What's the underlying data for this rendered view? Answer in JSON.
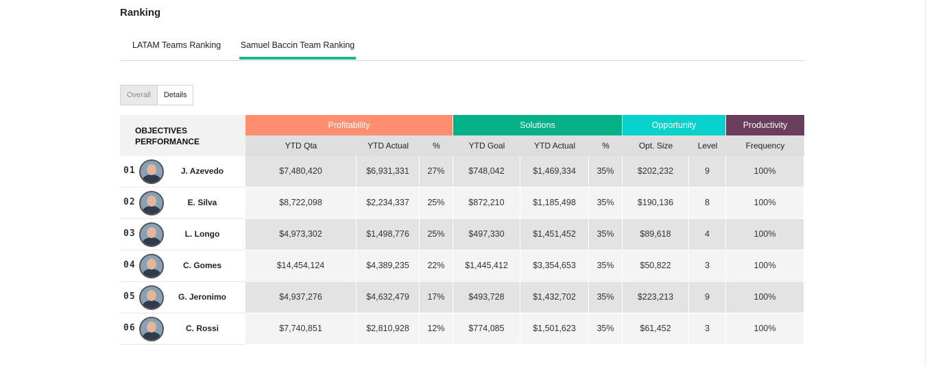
{
  "page": {
    "title": "Ranking"
  },
  "tabs": [
    "LATAM Teams Ranking",
    "Samuel Baccin Team Ranking"
  ],
  "active_tab": "Samuel Baccin Team Ranking",
  "view_toggle": {
    "options": [
      "Overall",
      "Details"
    ],
    "selected": "Details"
  },
  "table": {
    "corner_title": "OBJECTIVES PERFORMANCE",
    "groups": [
      {
        "label": "Profitability",
        "color": "#fd8f6f"
      },
      {
        "label": "Solutions",
        "color": "#04b187"
      },
      {
        "label": "Opportunity",
        "color": "#07d2cc"
      },
      {
        "label": "Productivity",
        "color": "#6a3d5c"
      }
    ],
    "columns": [
      "YTD Qta",
      "YTD Actual",
      "%",
      "YTD Goal",
      "YTD Actual",
      "%",
      "Opt. Size",
      "Level",
      "Frequency"
    ],
    "rows": [
      {
        "rank": "01",
        "name": "J. Azevedo",
        "values": [
          "$7,480,420",
          "$6,931,331",
          "27%",
          "$748,042",
          "$1,469,334",
          "35%",
          "$202,232",
          "9",
          "100%"
        ]
      },
      {
        "rank": "02",
        "name": "E. Silva",
        "values": [
          "$8,722,098",
          "$2,234,337",
          "25%",
          "$872,210",
          "$1,185,498",
          "35%",
          "$190,136",
          "8",
          "100%"
        ]
      },
      {
        "rank": "03",
        "name": "L. Longo",
        "values": [
          "$4,973,302",
          "$1,498,776",
          "25%",
          "$497,330",
          "$1,451,452",
          "35%",
          "$89,618",
          "4",
          "100%"
        ]
      },
      {
        "rank": "04",
        "name": "C. Gomes",
        "values": [
          "$14,454,124",
          "$4,389,235",
          "22%",
          "$1,445,412",
          "$3,354,653",
          "35%",
          "$50,822",
          "3",
          "100%"
        ]
      },
      {
        "rank": "05",
        "name": "G. Jeronimo",
        "values": [
          "$4,937,276",
          "$4,632,479",
          "17%",
          "$493,728",
          "$1,432,702",
          "35%",
          "$223,213",
          "9",
          "100%"
        ]
      },
      {
        "rank": "06",
        "name": "C. Rossi",
        "values": [
          "$7,740,851",
          "$2,810,928",
          "12%",
          "$774,085",
          "$1,501,623",
          "35%",
          "$61,452",
          "3",
          "100%"
        ]
      }
    ]
  }
}
